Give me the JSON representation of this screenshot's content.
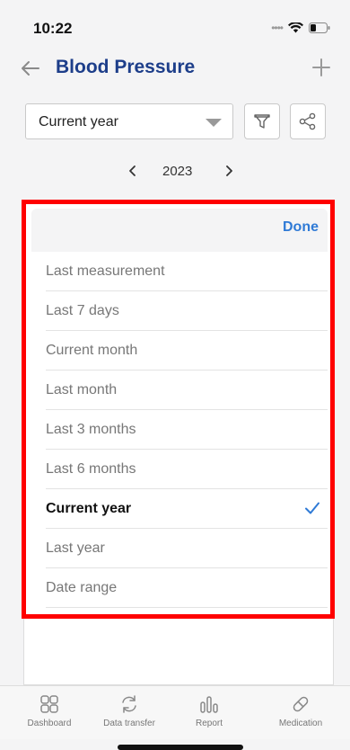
{
  "status": {
    "time": "10:22"
  },
  "header": {
    "title": "Blood Pressure"
  },
  "filter": {
    "selected_period": "Current year"
  },
  "year_nav": {
    "year": "2023"
  },
  "picker": {
    "done_label": "Done",
    "options": [
      {
        "label": "Last measurement"
      },
      {
        "label": "Last 7 days"
      },
      {
        "label": "Current month"
      },
      {
        "label": "Last month"
      },
      {
        "label": "Last 3 months"
      },
      {
        "label": "Last 6 months"
      },
      {
        "label": "Current year",
        "selected": true
      },
      {
        "label": "Last year"
      },
      {
        "label": "Date range"
      }
    ]
  },
  "tabbar": {
    "tabs": [
      {
        "label": "Dashboard",
        "icon": "dashboard-icon"
      },
      {
        "label": "Data transfer",
        "icon": "sync-icon"
      },
      {
        "label": "Report",
        "icon": "report-icon"
      },
      {
        "label": "Medication",
        "icon": "pill-icon"
      }
    ]
  },
  "colors": {
    "title": "#1d3e8a",
    "accent": "#2f7ad6",
    "highlight": "#ff0000"
  }
}
